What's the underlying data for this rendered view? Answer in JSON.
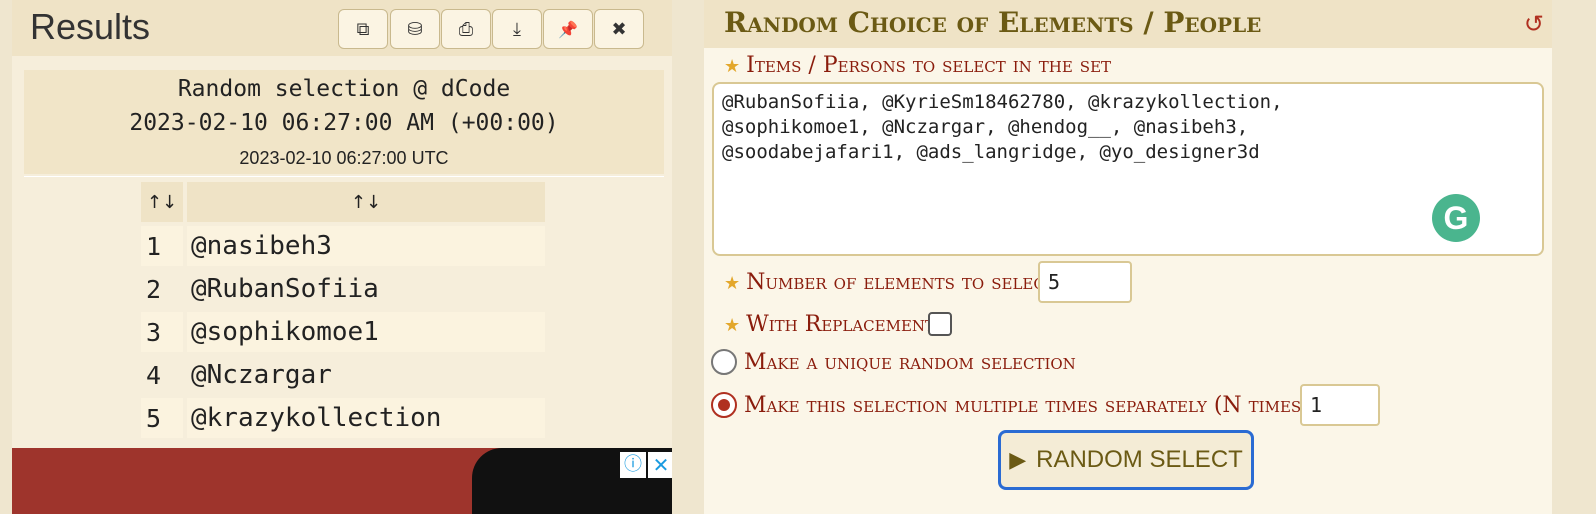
{
  "results": {
    "title": "Results",
    "toolbar": [
      {
        "icon": "copy-icon",
        "glyph": "⧉"
      },
      {
        "icon": "save-icon",
        "glyph": "⛁"
      },
      {
        "icon": "print-icon",
        "glyph": "⎙"
      },
      {
        "icon": "download-icon",
        "glyph": "⤓"
      },
      {
        "icon": "pin-icon",
        "glyph": "📌"
      },
      {
        "icon": "close-icon",
        "glyph": "✖"
      }
    ],
    "heading_line1": "Random selection @ dCode",
    "heading_line2": "2023-02-10 06:27:00 AM (+00:00)",
    "heading_line3": "2023-02-10 06:27:00 UTC",
    "table": {
      "headers": [
        "↑↓",
        "↑↓"
      ],
      "rows": [
        {
          "n": "1",
          "value": "@nasibeh3"
        },
        {
          "n": "2",
          "value": "@RubanSofiia"
        },
        {
          "n": "3",
          "value": "@sophikomoe1"
        },
        {
          "n": "4",
          "value": "@Nczargar"
        },
        {
          "n": "5",
          "value": "@krazykollection"
        }
      ]
    },
    "ad": {
      "info": "ⓘ",
      "close": "✕"
    }
  },
  "tool": {
    "title": "Random Choice of Elements / People",
    "reload_glyph": "↺",
    "items_label": "Items / Persons to select in the set",
    "items_value": "@RubanSofiia, @KyrieSm18462780, @krazykollection,\n@sophikomoe1, @Nczargar, @hendog__, @nasibeh3,\n@soodabejafari1, @ads_langridge, @yo_designer3d",
    "number_label": "Number of elements to select",
    "number_value": "5",
    "replacement_label": "With Replacement",
    "replacement_checked": false,
    "option_unique": "Make a unique random selection",
    "option_multiple": "Make this selection multiple times separately (N times) N=",
    "n_value": "1",
    "selected_option": "multiple",
    "button_label": "RANDOM SELECT",
    "star_glyph": "★",
    "play_glyph": "▶",
    "grammarly_glyph": "G"
  }
}
